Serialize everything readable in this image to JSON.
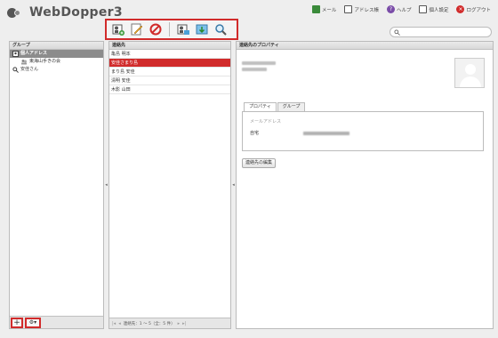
{
  "app": {
    "logo_text": "WebDopper3"
  },
  "topnav": [
    {
      "label": "メール",
      "icon": "mail-icon",
      "color": "#3a8a3a"
    },
    {
      "label": "アドレス帳",
      "icon": "addressbook-icon",
      "color": "#555555"
    },
    {
      "label": "ヘルプ",
      "icon": "help-icon",
      "color": "#7a4ca8"
    },
    {
      "label": "個人設定",
      "icon": "settings-icon",
      "color": "#555555"
    },
    {
      "label": "ログアウト",
      "icon": "logout-icon",
      "color": "#d12b2b"
    }
  ],
  "toolbar": {
    "buttons": [
      "add-contact-icon",
      "edit-icon",
      "delete-icon",
      "import-icon",
      "export-icon",
      "search-icon"
    ]
  },
  "search": {
    "placeholder": ""
  },
  "left_panel": {
    "header": "グループ",
    "items": [
      {
        "label": "個人アドレス",
        "selected": true
      },
      {
        "label": "東海山手きの会",
        "sub": true
      },
      {
        "label": "安佳さん"
      }
    ]
  },
  "mid_panel": {
    "header": "連絡先",
    "contacts": [
      "亀島 明本",
      "安佳さまり島",
      "まり島 安佳",
      "清明 安佳",
      "木影 山田"
    ],
    "selected_index": 1,
    "pager": "連絡先：1 〜 5（全：5 件）"
  },
  "right_panel": {
    "header": "連絡先のプロパティ",
    "tabs": [
      "プロパティ",
      "グループ"
    ],
    "active_tab": 0,
    "mail_label": "メールアドレス",
    "home_label": "自宅",
    "edit_button": "連絡先の編集"
  },
  "colors": {
    "accent": "#d12b2b",
    "selected_group": "#8c8c8c"
  }
}
